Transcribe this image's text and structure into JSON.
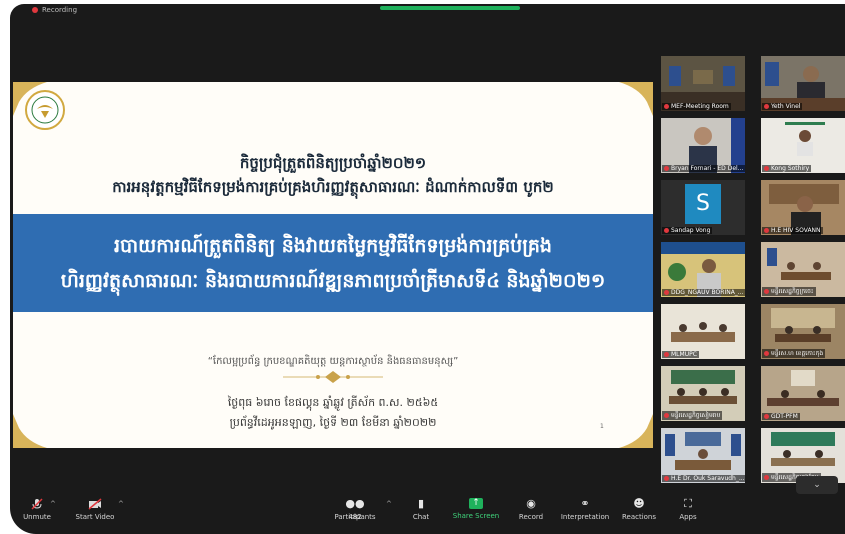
{
  "recording_label": "Recording",
  "slide": {
    "title_line1": "កិច្ចប្រជុំត្រួតពិនិត្យប្រចាំឆ្នាំ២០២១",
    "title_line2": "ការអនុវត្តកម្មវិធីកែទម្រង់ការគ្រប់គ្រងហិរញ្ញវត្ថុសាធារណៈ ដំណាក់កាលទី៣ បូក២",
    "band_line1": "របាយការណ៍ត្រួតពិនិត្យ និងវាយតម្លៃកម្មវិធីកែទម្រង់ការគ្រប់គ្រង",
    "band_line2": "ហិរញ្ញវត្ថុសាធារណៈ និងរបាយការណ៍វឌ្ឍនភាពប្រចាំត្រីមាសទី៤ និងឆ្នាំ២០២១",
    "motto": "“កែលម្អប្រព័ន្ធ ក្របខណ្ឌគតិយុត្ត យន្តការស្ថាប័ន និងធនធានមនុស្ស”",
    "date_line1": "ថ្ងៃពុធ ៦រោច ខែផល្គុន ឆ្នាំឆ្លូវ ត្រីស័ក ព.ស. ២៥៦៥",
    "date_line2": "ប្រព័ន្ធវីដេអូអនឡាញ, ថ្ងៃទី ២៣ ខែមីនា ឆ្នាំ២០២២",
    "page_number": "1",
    "band_color": "#2f6db2"
  },
  "participants_gallery": [
    {
      "name": "MEF-Meeting Room",
      "muted": true
    },
    {
      "name": "Yeth Vinel",
      "muted": true,
      "active": true
    },
    {
      "name": "Bryan Fornari - ED Del...",
      "muted": true
    },
    {
      "name": "Kong Sothiry",
      "muted": true
    },
    {
      "name": "Sandap Vong",
      "muted": true,
      "avatar_letter": "S"
    },
    {
      "name": "H.E HIV SOVANN",
      "muted": true
    },
    {
      "name": "DDG_NGAUV BORINA_...",
      "muted": true
    },
    {
      "name": "មន្ទីរសេដ្ឋកិច្ចក្រចេះ",
      "muted": true
    },
    {
      "name": "MLMUPC",
      "muted": true
    },
    {
      "name": "មន្ទីរស.ហ ខេត្តកោះកុង",
      "muted": true
    },
    {
      "name": "មន្ទីរសេដ្ឋកិច្ចសៀមរាប",
      "muted": true
    },
    {
      "name": "GDT-PFM",
      "muted": true
    },
    {
      "name": "H.E Dr. Ouk Saravudh_...",
      "muted": true
    },
    {
      "name": "មន្ទីរសេដ្ឋកិច្ចក្រុងកែប",
      "muted": true
    }
  ],
  "collapse_icon": "chevron-down-icon",
  "toolbar": {
    "mute_label": "Unmute",
    "video_label": "Start Video",
    "participants_label": "Participants",
    "participants_count": "482",
    "chat_label": "Chat",
    "share_label": "Share Screen",
    "record_label": "Record",
    "interpretation_label": "Interpretation",
    "reactions_label": "Reactions",
    "apps_label": "Apps",
    "share_color": "#1fb15c"
  }
}
